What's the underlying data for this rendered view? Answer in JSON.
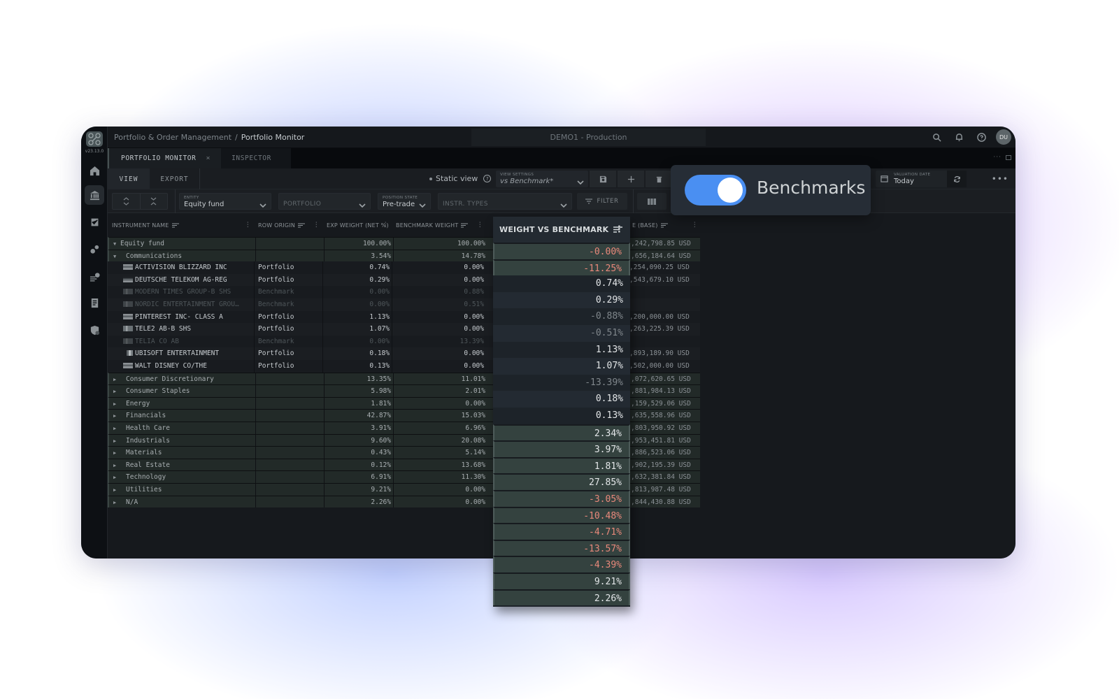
{
  "app": {
    "version": "v23.13.0",
    "breadcrumb": [
      "Portfolio & Order Management",
      "Portfolio Monitor"
    ],
    "breadcrumb_separator": "/",
    "environment": "DEMO1 - Production",
    "user_initials": "DU",
    "top_icons": [
      "search-icon",
      "bell-icon",
      "help-icon"
    ]
  },
  "sidebar": {
    "items": [
      {
        "icon": "home-icon",
        "active": false
      },
      {
        "icon": "bank-icon",
        "active": true
      },
      {
        "icon": "clipboard-check-icon",
        "active": false
      },
      {
        "icon": "gears-icon",
        "active": false
      },
      {
        "icon": "list-check-icon",
        "active": false
      },
      {
        "icon": "document-icon",
        "active": false
      },
      {
        "icon": "shield-user-icon",
        "active": false
      }
    ]
  },
  "tabs": [
    {
      "label": "PORTFOLIO MONITOR",
      "active": true,
      "closable": true,
      "close_glyph": "×"
    },
    {
      "label": "INSPECTOR",
      "active": false
    }
  ],
  "tabbar_more": "···",
  "viewbar": {
    "tabs": [
      "VIEW",
      "EXPORT"
    ],
    "static_view_label": "Static view",
    "help_glyph": "?",
    "view_settings": {
      "label": "VIEW SETTINGS",
      "value": "vs Benchmark*"
    },
    "valuation_date": {
      "label": "VALUATION DATE",
      "value": "Today"
    },
    "more_glyph": "•••"
  },
  "filterbar": {
    "expand_glyph": "⌃⌄",
    "collapse_glyph": "⌄⌃",
    "entity": {
      "label": "ENTITY",
      "value": "Equity fund"
    },
    "portfolio": {
      "placeholder": "PORTFOLIO"
    },
    "position_state": {
      "label": "POSITION STATE",
      "value": "Pre-trade"
    },
    "instr_types": {
      "placeholder": "INSTR. TYPES"
    },
    "filter_label": "FILTER"
  },
  "toggle": {
    "label": "Benchmarks",
    "on": true,
    "accent": "#4a8ff2"
  },
  "grid": {
    "columns": {
      "instrument_name": "INSTRUMENT NAME",
      "row_origin": "ROW ORIGIN",
      "exp_weight": "EXP WEIGHT (NET %)",
      "benchmark_weight": "BENCHMARK WEIGHT",
      "weight_vs_benchmark": "WEIGHT VS BENCHMARK",
      "market_value": "E (BASE)"
    },
    "rows": [
      {
        "type": "group",
        "level": 0,
        "expanded": true,
        "name": "Equity fund",
        "origin": "",
        "exp": "100.00%",
        "bench": "100.00%",
        "vs": "-0.00%",
        "mv": ",242,798.85 USD"
      },
      {
        "type": "group",
        "level": 1,
        "expanded": true,
        "name": "Communications",
        "origin": "",
        "exp": "3.54%",
        "bench": "14.78%",
        "vs": "-11.25%",
        "mv": ",656,184.64 USD"
      },
      {
        "type": "leaf",
        "flag": "us",
        "name": "ACTIVISION BLIZZARD INC",
        "origin": "Portfolio",
        "exp": "0.74%",
        "bench": "0.00%",
        "vs": "0.74%",
        "mv": ",254,090.25 USD"
      },
      {
        "type": "leaf",
        "flag": "de",
        "name": "DEUTSCHE TELEKOM AG-REG",
        "origin": "Portfolio",
        "exp": "0.29%",
        "bench": "0.00%",
        "vs": "0.29%",
        "mv": ",543,679.10 USD"
      },
      {
        "type": "leaf",
        "flag": "se",
        "name": "MODERN TIMES GROUP-B SHS",
        "origin": "Benchmark",
        "exp": "0.00%",
        "bench": "0.88%",
        "vs": "-0.88%",
        "mv": ""
      },
      {
        "type": "leaf",
        "flag": "se",
        "name": "NORDIC ENTERTAINMENT GROU…",
        "origin": "Benchmark",
        "exp": "0.00%",
        "bench": "0.51%",
        "vs": "-0.51%",
        "mv": ""
      },
      {
        "type": "leaf",
        "flag": "us",
        "name": "PINTEREST INC- CLASS A",
        "origin": "Portfolio",
        "exp": "1.13%",
        "bench": "0.00%",
        "vs": "1.13%",
        "mv": ",200,000.00 USD"
      },
      {
        "type": "leaf",
        "flag": "se",
        "name": "TELE2 AB-B SHS",
        "origin": "Portfolio",
        "exp": "1.07%",
        "bench": "0.00%",
        "vs": "1.07%",
        "mv": ",263,225.39 USD"
      },
      {
        "type": "leaf",
        "flag": "se",
        "name": "TELIA CO AB",
        "origin": "Benchmark",
        "exp": "0.00%",
        "bench": "13.39%",
        "vs": "-13.39%",
        "mv": ""
      },
      {
        "type": "leaf",
        "flag": "fr",
        "name": "UBISOFT ENTERTAINMENT",
        "origin": "Portfolio",
        "exp": "0.18%",
        "bench": "0.00%",
        "vs": "0.18%",
        "mv": ",893,189.90 USD"
      },
      {
        "type": "leaf",
        "flag": "us",
        "name": "WALT DISNEY CO/THE",
        "origin": "Portfolio",
        "exp": "0.13%",
        "bench": "0.00%",
        "vs": "0.13%",
        "mv": ",502,000.00 USD"
      },
      {
        "type": "group",
        "level": 1,
        "expanded": false,
        "name": "Consumer Discretionary",
        "origin": "",
        "exp": "13.35%",
        "bench": "11.01%",
        "vs": "2.34%",
        "mv": ",072,620.65 USD"
      },
      {
        "type": "group",
        "level": 1,
        "expanded": false,
        "name": "Consumer Staples",
        "origin": "",
        "exp": "5.98%",
        "bench": "2.01%",
        "vs": "3.97%",
        "mv": ",881,984.13 USD"
      },
      {
        "type": "group",
        "level": 1,
        "expanded": false,
        "name": "Energy",
        "origin": "",
        "exp": "1.81%",
        "bench": "0.00%",
        "vs": "1.81%",
        "mv": ",159,529.06 USD"
      },
      {
        "type": "group",
        "level": 1,
        "expanded": false,
        "name": "Financials",
        "origin": "",
        "exp": "42.87%",
        "bench": "15.03%",
        "vs": "27.85%",
        "mv": ",635,558.96 USD"
      },
      {
        "type": "group",
        "level": 1,
        "expanded": false,
        "name": "Health Care",
        "origin": "",
        "exp": "3.91%",
        "bench": "6.96%",
        "vs": "-3.05%",
        "mv": ",803,950.92 USD"
      },
      {
        "type": "group",
        "level": 1,
        "expanded": false,
        "name": "Industrials",
        "origin": "",
        "exp": "9.60%",
        "bench": "20.08%",
        "vs": "-10.48%",
        "mv": ",953,451.81 USD"
      },
      {
        "type": "group",
        "level": 1,
        "expanded": false,
        "name": "Materials",
        "origin": "",
        "exp": "0.43%",
        "bench": "5.14%",
        "vs": "-4.71%",
        "mv": ",886,523.06 USD"
      },
      {
        "type": "group",
        "level": 1,
        "expanded": false,
        "name": "Real Estate",
        "origin": "",
        "exp": "0.12%",
        "bench": "13.68%",
        "vs": "-13.57%",
        "mv": ",902,195.39 USD"
      },
      {
        "type": "group",
        "level": 1,
        "expanded": false,
        "name": "Technology",
        "origin": "",
        "exp": "6.91%",
        "bench": "11.30%",
        "vs": "-4.39%",
        "mv": ",632,381.84 USD"
      },
      {
        "type": "group",
        "level": 1,
        "expanded": false,
        "name": "Utilities",
        "origin": "",
        "exp": "9.21%",
        "bench": "0.00%",
        "vs": "9.21%",
        "mv": ",813,987.48 USD"
      },
      {
        "type": "group",
        "level": 1,
        "expanded": false,
        "name": "N/A",
        "origin": "",
        "exp": "2.26%",
        "bench": "0.00%",
        "vs": "2.26%",
        "mv": ",844,430.88 USD"
      }
    ]
  },
  "colors": {
    "negative": "#e9897b",
    "accent": "#4a8ff2",
    "background": "#16191d"
  }
}
